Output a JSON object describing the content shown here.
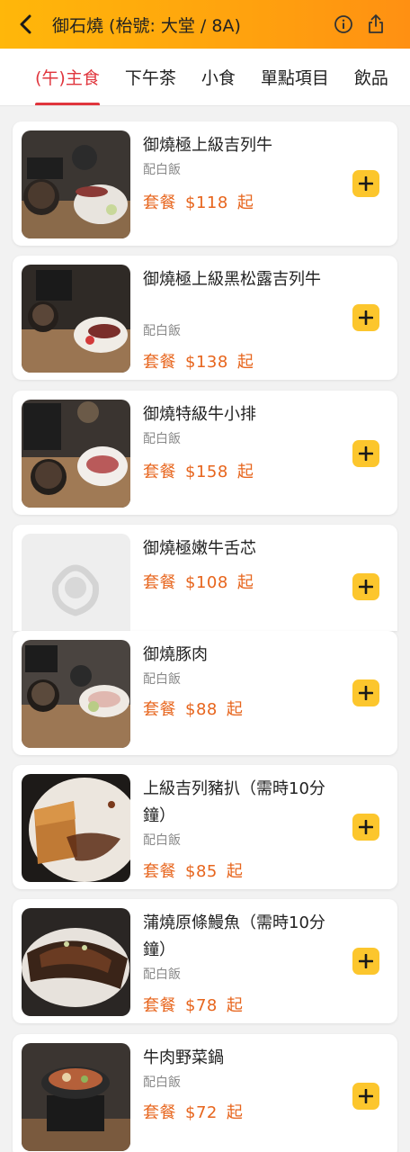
{
  "header": {
    "title": "御石燒 (枱號: 大堂 / 8A)",
    "back_icon": "chevron-left-icon",
    "info_icon": "info-icon",
    "share_icon": "share-icon"
  },
  "tabs": [
    {
      "label": "(午)主食",
      "active": true
    },
    {
      "label": "下午茶"
    },
    {
      "label": "小食"
    },
    {
      "label": "單點項目"
    },
    {
      "label": "飲品"
    }
  ],
  "price_prefix": "套餐",
  "price_suffix": "起",
  "items": [
    {
      "name": "御燒極上級吉列牛",
      "sub": "配白飯",
      "price": "$118"
    },
    {
      "name": "御燒極上級黑松露吉列牛",
      "sub": "配白飯",
      "price": "$138"
    },
    {
      "name": "御燒特級牛小排",
      "sub": "配白飯",
      "price": "$158"
    },
    {
      "name": "御燒極嫩牛舌芯",
      "sub": "",
      "price": "$108"
    },
    {
      "name": "御燒豚肉",
      "sub": "配白飯",
      "price": "$88"
    },
    {
      "name": "上級吉列豬扒（需時10分鐘）",
      "sub": "配白飯",
      "price": "$85"
    },
    {
      "name": "蒲燒原條鰻魚（需時10分鐘）",
      "sub": "配白飯",
      "price": "$78"
    },
    {
      "name": "牛肉野菜鍋",
      "sub": "配白飯",
      "price": "$72"
    }
  ],
  "colors": {
    "header_gradient_start": "#ffb70a",
    "header_gradient_end": "#ff9012",
    "active_tab": "#e0353d",
    "price": "#e7651d",
    "add_button": "#fcc62d"
  }
}
